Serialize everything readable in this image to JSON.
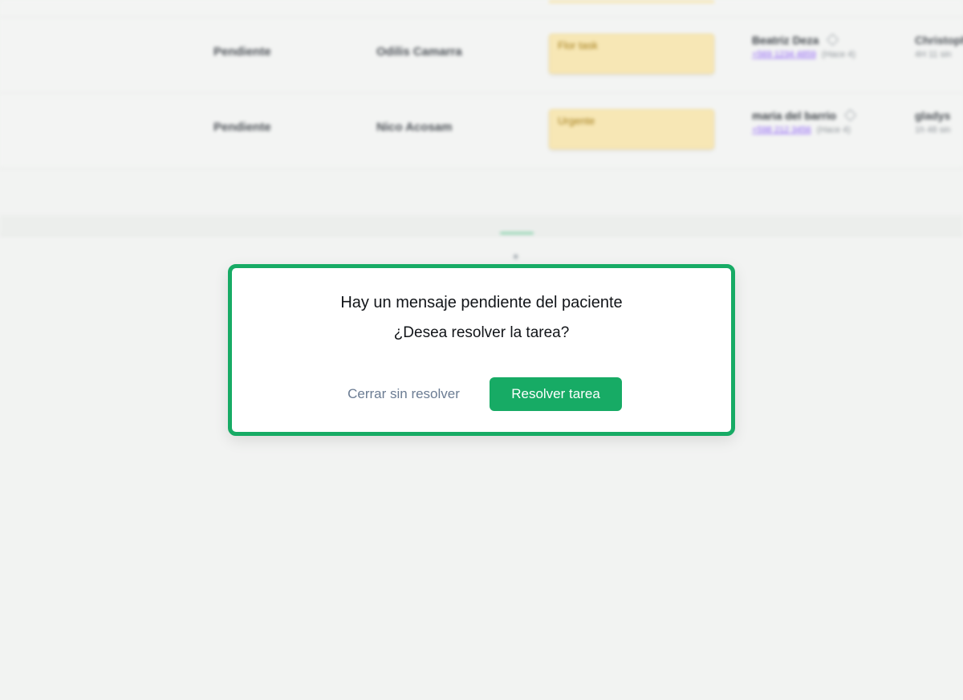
{
  "background_table": {
    "rows": [
      {
        "status": "Pendiente",
        "patient": "Odilis Camarra",
        "note": "Flor task",
        "person_name": "Beatriz Deza",
        "person_phone": "+569 1234 4859",
        "person_age": "(Hace 4)",
        "extra_name": "Christopher",
        "extra_sub": "4H 11 sin"
      },
      {
        "status": "Pendiente",
        "patient": "Nico Acosam",
        "note": "Urgente",
        "person_name": "maria del barrio",
        "person_phone": "+598 212 3456",
        "person_age": "(Hace 4)",
        "extra_name": "gladys",
        "extra_sub": "1h 48 sin"
      }
    ]
  },
  "modal": {
    "title": "Hay un mensaje pendiente del paciente",
    "question": "¿Desea resolver la tarea?",
    "secondary_button": "Cerrar sin resolver",
    "primary_button": "Resolver tarea"
  },
  "colors": {
    "accent": "#17ab65",
    "secondary_text": "#6b7c93",
    "note_bg": "#f7e7b5"
  }
}
